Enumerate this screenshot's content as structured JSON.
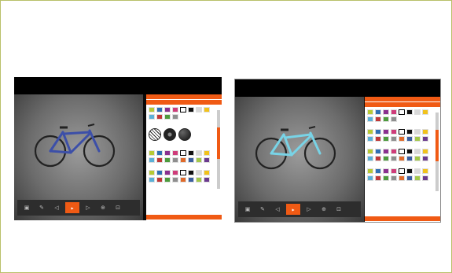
{
  "configurator": {
    "shots": [
      {
        "id": "shot1",
        "bike_colors": {
          "frame": "#3c4fa8",
          "accent": "#2a2a2a"
        },
        "tools": [
          {
            "icon": "paint-bucket-icon"
          },
          {
            "icon": "brush-icon"
          },
          {
            "icon": "rotate-left-icon"
          },
          {
            "icon": "brand-logo-icon",
            "active": true
          },
          {
            "icon": "rotate-right-icon"
          },
          {
            "icon": "zoom-icon"
          },
          {
            "icon": "fullscreen-icon"
          }
        ],
        "swatch_rows": [
          [
            "#b7c934",
            "#2f6fb3",
            "#8a2f8f",
            "#cf3b79",
            "#ffffff",
            "#111111",
            "#d9d9d9",
            "#f1c21b"
          ],
          [
            "#5bb0d7",
            "#c03737",
            "#4c9b3c",
            "#8e8e8e"
          ]
        ],
        "swatch_rows_2": [
          [
            "#b7c934",
            "#2f6fb3",
            "#8a2f8f",
            "#cf3b79",
            "#ffffff",
            "#111111",
            "#d9d9d9",
            "#f1c21b"
          ],
          [
            "#5bb0d7",
            "#c03737",
            "#4c9b3c",
            "#8e8e8e",
            "#e06a2a",
            "#3a5fa0",
            "#a3c84a",
            "#6b3a8f"
          ]
        ],
        "swatch_rows_3": [
          [
            "#b7c934",
            "#2f6fb3",
            "#8a2f8f",
            "#cf3b79",
            "#ffffff",
            "#111111",
            "#d9d9d9",
            "#f1c21b"
          ],
          [
            "#5bb0d7",
            "#c03737",
            "#4c9b3c",
            "#8e8e8e",
            "#e06a2a",
            "#3a5fa0",
            "#a3c84a",
            "#6b3a8f"
          ]
        ]
      },
      {
        "id": "shot2",
        "bike_colors": {
          "frame": "#78d3e6",
          "accent": "#2a2a2a"
        },
        "tools": [
          {
            "icon": "paint-bucket-icon"
          },
          {
            "icon": "brush-icon"
          },
          {
            "icon": "rotate-left-icon"
          },
          {
            "icon": "brand-logo-icon",
            "active": true
          },
          {
            "icon": "rotate-right-icon"
          },
          {
            "icon": "zoom-icon"
          },
          {
            "icon": "fullscreen-icon"
          }
        ],
        "swatch_rows": [
          [
            "#b7c934",
            "#2f6fb3",
            "#8a2f8f",
            "#cf3b79",
            "#ffffff",
            "#111111",
            "#d9d9d9",
            "#f1c21b"
          ],
          [
            "#5bb0d7",
            "#c03737",
            "#4c9b3c",
            "#8e8e8e"
          ]
        ],
        "swatch_rows_2": [
          [
            "#b7c934",
            "#2f6fb3",
            "#8a2f8f",
            "#cf3b79",
            "#ffffff",
            "#111111",
            "#d9d9d9",
            "#f1c21b"
          ],
          [
            "#5bb0d7",
            "#c03737",
            "#4c9b3c",
            "#8e8e8e",
            "#e06a2a",
            "#3a5fa0",
            "#a3c84a",
            "#6b3a8f"
          ]
        ],
        "swatch_rows_3": [
          [
            "#b7c934",
            "#2f6fb3",
            "#8a2f8f",
            "#cf3b79",
            "#ffffff",
            "#111111",
            "#d9d9d9",
            "#f1c21b"
          ],
          [
            "#5bb0d7",
            "#c03737",
            "#4c9b3c",
            "#8e8e8e",
            "#e06a2a",
            "#3a5fa0",
            "#a3c84a",
            "#6b3a8f"
          ]
        ],
        "swatch_rows_4": [
          [
            "#b7c934",
            "#2f6fb3",
            "#8a2f8f",
            "#cf3b79",
            "#ffffff",
            "#111111",
            "#d9d9d9",
            "#f1c21b"
          ],
          [
            "#5bb0d7",
            "#c03737",
            "#4c9b3c",
            "#8e8e8e",
            "#e06a2a",
            "#3a5fa0",
            "#a3c84a",
            "#6b3a8f"
          ]
        ]
      }
    ],
    "accent_color": "#f05a14",
    "border_color": "#b9c06a"
  }
}
